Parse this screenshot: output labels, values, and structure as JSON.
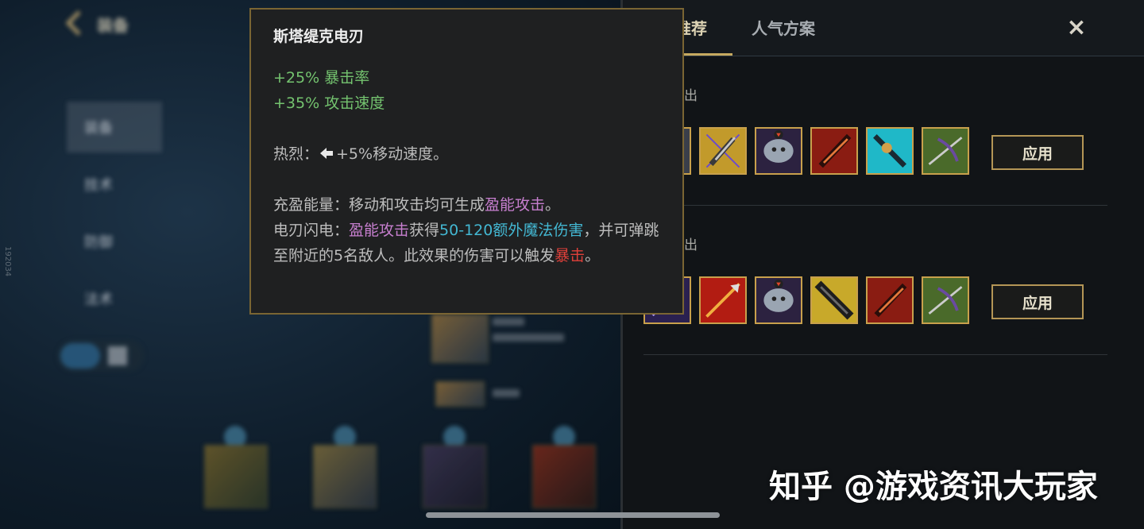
{
  "left": {
    "back_label": "装备",
    "side_id": "192034",
    "sidebar": [
      {
        "label": "装备"
      },
      {
        "label": "技术"
      },
      {
        "label": "防御"
      },
      {
        "label": "法术"
      }
    ]
  },
  "panel": {
    "tabs": [
      {
        "label": "官方推荐"
      },
      {
        "label": "人气方案"
      }
    ],
    "close_icon": "×",
    "builds": [
      {
        "title": "强力输出",
        "apply_label": "应用",
        "items": [
          "staff-icon",
          "dagger-icon",
          "spirit-icon",
          "blade-red-icon",
          "katana-cyan-icon",
          "crossbow-icon"
        ]
      },
      {
        "title": "暴击输出",
        "apply_label": "应用",
        "items": [
          "shadow-blade-icon",
          "spear-red-icon",
          "spirit-icon",
          "stattik-shiv-icon",
          "blade-red-icon",
          "crossbow-icon"
        ]
      }
    ]
  },
  "tooltip": {
    "title": "斯塔缇克电刃",
    "stat1": "+25% 暴击率",
    "stat2": "+35% 攻击速度",
    "passive1_label": "热烈：",
    "passive1_text": "+5%移动速度。",
    "passive2_label": "充盈能量：",
    "passive2_text": "移动和攻击均可生成",
    "passive2_keyword": "盈能攻击",
    "passive2_end": "。",
    "passive3_label": "电刃闪电：",
    "passive3_keyword": "盈能攻击",
    "passive3_mid": "获得",
    "passive3_damage": "50-120额外魔法伤害",
    "passive3_text1": "，并可弹跳至附近的5名敌人。此效果的伤害可以触发",
    "passive3_crit": "暴击",
    "passive3_end": "。"
  },
  "watermark": "知乎 @游戏资讯大玩家",
  "colors": {
    "accent_gold": "#c6a960",
    "stat_green": "#74c36f",
    "keyword_magenta": "#c77fcf",
    "damage_cyan": "#43b7d2",
    "crit_red": "#e0403a"
  }
}
